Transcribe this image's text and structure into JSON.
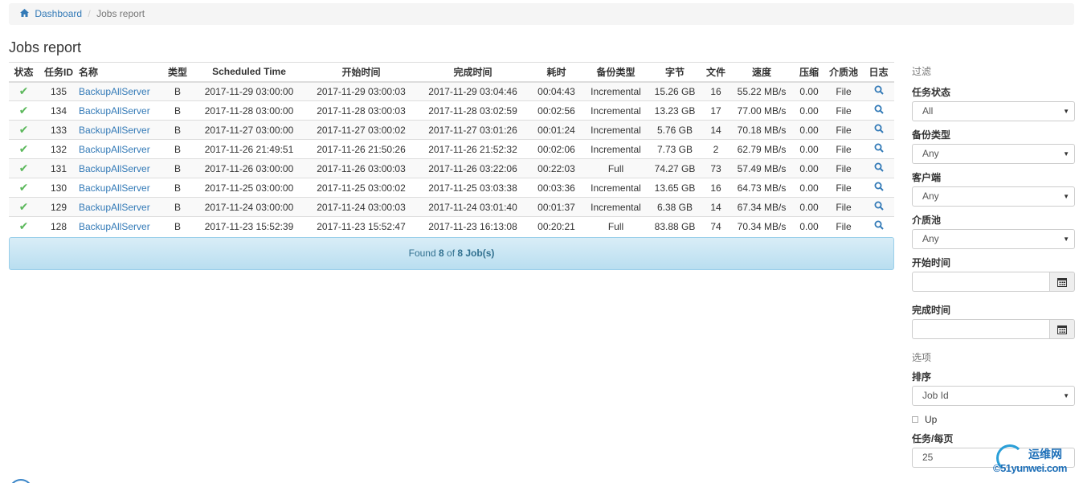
{
  "breadcrumb": {
    "home": "Dashboard",
    "current": "Jobs report",
    "separator": "/"
  },
  "page_title": "Jobs report",
  "table": {
    "headers": [
      "状态",
      "任务ID",
      "名称",
      "类型",
      "Scheduled Time",
      "开始时间",
      "完成时间",
      "耗时",
      "备份类型",
      "字节",
      "文件",
      "速度",
      "压缩",
      "介质池",
      "日志"
    ],
    "rows": [
      {
        "id": "135",
        "name": "BackupAllServer",
        "type": "B",
        "scheduled": "2017-11-29 03:00:00",
        "start": "2017-11-29 03:00:03",
        "end": "2017-11-29 03:04:46",
        "duration": "00:04:43",
        "level": "Incremental",
        "bytes": "15.26 GB",
        "files": "16",
        "speed": "55.22 MB/s",
        "compression": "0.00",
        "pool": "File"
      },
      {
        "id": "134",
        "name": "BackupAllServer",
        "type": "B",
        "scheduled": "2017-11-28 03:00:00",
        "start": "2017-11-28 03:00:03",
        "end": "2017-11-28 03:02:59",
        "duration": "00:02:56",
        "level": "Incremental",
        "bytes": "13.23 GB",
        "files": "17",
        "speed": "77.00 MB/s",
        "compression": "0.00",
        "pool": "File"
      },
      {
        "id": "133",
        "name": "BackupAllServer",
        "type": "B",
        "scheduled": "2017-11-27 03:00:00",
        "start": "2017-11-27 03:00:02",
        "end": "2017-11-27 03:01:26",
        "duration": "00:01:24",
        "level": "Incremental",
        "bytes": "5.76 GB",
        "files": "14",
        "speed": "70.18 MB/s",
        "compression": "0.00",
        "pool": "File"
      },
      {
        "id": "132",
        "name": "BackupAllServer",
        "type": "B",
        "scheduled": "2017-11-26 21:49:51",
        "start": "2017-11-26 21:50:26",
        "end": "2017-11-26 21:52:32",
        "duration": "00:02:06",
        "level": "Incremental",
        "bytes": "7.73 GB",
        "files": "2",
        "speed": "62.79 MB/s",
        "compression": "0.00",
        "pool": "File"
      },
      {
        "id": "131",
        "name": "BackupAllServer",
        "type": "B",
        "scheduled": "2017-11-26 03:00:00",
        "start": "2017-11-26 03:00:03",
        "end": "2017-11-26 03:22:06",
        "duration": "00:22:03",
        "level": "Full",
        "bytes": "74.27 GB",
        "files": "73",
        "speed": "57.49 MB/s",
        "compression": "0.00",
        "pool": "File"
      },
      {
        "id": "130",
        "name": "BackupAllServer",
        "type": "B",
        "scheduled": "2017-11-25 03:00:00",
        "start": "2017-11-25 03:00:02",
        "end": "2017-11-25 03:03:38",
        "duration": "00:03:36",
        "level": "Incremental",
        "bytes": "13.65 GB",
        "files": "16",
        "speed": "64.73 MB/s",
        "compression": "0.00",
        "pool": "File"
      },
      {
        "id": "129",
        "name": "BackupAllServer",
        "type": "B",
        "scheduled": "2017-11-24 03:00:00",
        "start": "2017-11-24 03:00:03",
        "end": "2017-11-24 03:01:40",
        "duration": "00:01:37",
        "level": "Incremental",
        "bytes": "6.38 GB",
        "files": "14",
        "speed": "67.34 MB/s",
        "compression": "0.00",
        "pool": "File"
      },
      {
        "id": "128",
        "name": "BackupAllServer",
        "type": "B",
        "scheduled": "2017-11-23 15:52:39",
        "start": "2017-11-23 15:52:47",
        "end": "2017-11-23 16:13:08",
        "duration": "00:20:21",
        "level": "Full",
        "bytes": "83.88 GB",
        "files": "74",
        "speed": "70.34 MB/s",
        "compression": "0.00",
        "pool": "File"
      }
    ],
    "status_icon": "check-icon",
    "log_icon": "search-icon"
  },
  "found": {
    "prefix": "Found",
    "count": "8",
    "of": "of",
    "total": "8 Job(s)"
  },
  "sidebar": {
    "filter_heading": "过滤",
    "job_status_label": "任务状态",
    "job_status_value": "All",
    "level_label": "备份类型",
    "level_value": "Any",
    "client_label": "客户端",
    "client_value": "Any",
    "pool_label": "介质池",
    "pool_value": "Any",
    "start_label": "开始时间",
    "end_label": "完成时间",
    "options_heading": "选项",
    "sort_label": "排序",
    "sort_value": "Job Id",
    "up_label": "Up",
    "per_page_label": "任务/每页",
    "per_page_value": "25"
  },
  "watermark": {
    "top": "运维网",
    "bottom": "©51yunwei.com"
  },
  "colors": {
    "link": "#337ab7",
    "success": "#5cb85c",
    "info_bg": "#d9edf7",
    "info_text": "#31708f"
  }
}
